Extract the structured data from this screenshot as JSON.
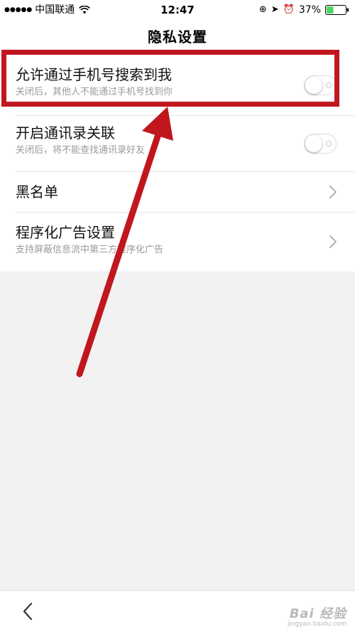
{
  "status_bar": {
    "carrier": "中国联通",
    "time": "12:47",
    "battery_percent": "37%",
    "battery_level": 0.37,
    "icons": [
      "signal-dots-icon",
      "wifi-icon",
      "orientation-lock-icon",
      "location-icon",
      "alarm-icon",
      "battery-icon"
    ]
  },
  "nav": {
    "title": "隐私设置"
  },
  "settings": {
    "items": [
      {
        "title": "允许通过手机号搜索到我",
        "subtitle": "关闭后，其他人不能通过手机号找到你",
        "control": "toggle",
        "state": "off"
      },
      {
        "title": "开启通讯录关联",
        "subtitle": "关闭后，将不能查找通讯录好友",
        "control": "toggle",
        "state": "off"
      },
      {
        "title": "黑名单",
        "control": "chevron"
      },
      {
        "title": "程序化广告设置",
        "subtitle": "支持屏蔽信息流中第三方程序化广告",
        "control": "chevron"
      }
    ]
  },
  "annotation": {
    "color": "#c0171e",
    "icons": [
      "highlight-box",
      "pointer-arrow"
    ]
  },
  "bottom_bar": {
    "icons": [
      "back-chevron-icon"
    ]
  },
  "watermark": {
    "logo": "Bai 经验",
    "url": "jingyan.baidu.com"
  },
  "colors": {
    "background": "#f2f2f2",
    "card": "#ffffff",
    "subtitle": "#9a9a9a",
    "accent_red": "#c0171e"
  }
}
